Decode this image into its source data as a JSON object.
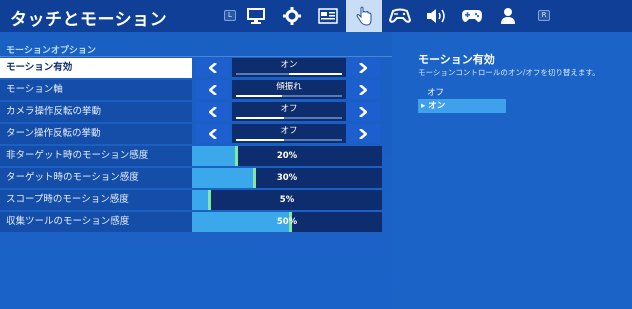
{
  "header": {
    "title": "タッチとモーション",
    "left_shoulder": "L",
    "right_shoulder": "R",
    "tabs": [
      {
        "icon": "monitor-icon"
      },
      {
        "icon": "gear-icon"
      },
      {
        "icon": "interface-icon"
      },
      {
        "icon": "touch-hand-icon",
        "active": true
      },
      {
        "icon": "input-controller-icon"
      },
      {
        "icon": "speaker-icon"
      },
      {
        "icon": "gamepad-icon"
      },
      {
        "icon": "account-icon"
      }
    ]
  },
  "motion": {
    "section_title": "モーションオプション",
    "rows": [
      {
        "label": "モーション有効",
        "value": "オン",
        "selected": true
      },
      {
        "label": "モーション軸",
        "value": "傾振れ"
      },
      {
        "label": "カメラ操作反転の挙動",
        "value": "オフ"
      },
      {
        "label": "ターン操作反転の挙動",
        "value": "オフ"
      }
    ],
    "sliders": [
      {
        "label": "非ターゲット時のモーション感度",
        "value_text": "20%",
        "value": 0.2
      },
      {
        "label": "ターゲット時のモーション感度",
        "value_text": "30%",
        "value": 0.3
      },
      {
        "label": "スコープ時のモーション感度",
        "value_text": "5%",
        "value": 0.05
      },
      {
        "label": "収集ツールのモーション感度",
        "value_text": "50%",
        "value": 0.5
      }
    ]
  },
  "detail": {
    "title": "モーション有効",
    "description": "モーションコントロールのオン/オフを切り替えます。",
    "options": [
      {
        "label": "オフ",
        "selected": false
      },
      {
        "label": "オン",
        "selected": true,
        "marker": "▸"
      }
    ]
  },
  "colors": {
    "background": "#1b63c6",
    "header": "#0f3f96",
    "slider_fill": "#3aa8ea",
    "slider_knob": "#7fe8a2",
    "selected_option": "#3fa0ec"
  }
}
